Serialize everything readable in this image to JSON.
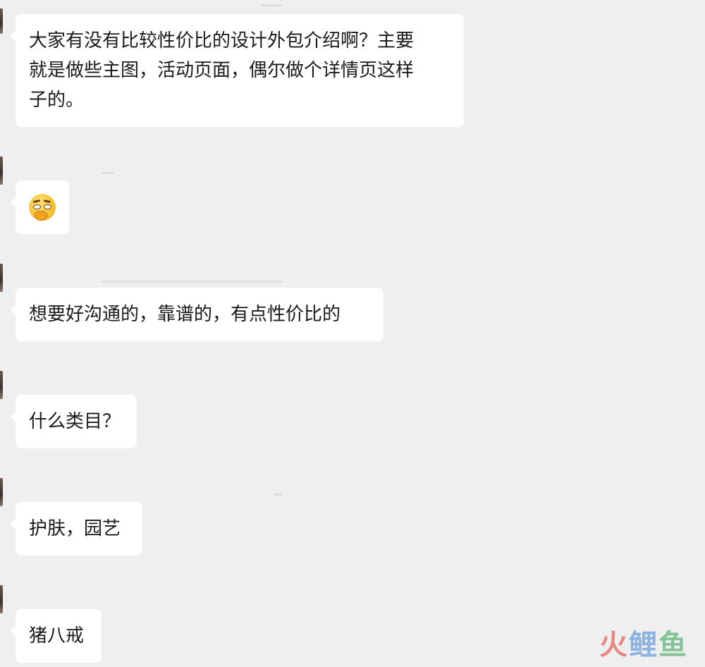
{
  "messages": [
    {
      "text": "大家有没有比较性价比的设计外包介绍啊？主要\n就是做些主图，活动页面，偶尔做个详情页这样\n子的。"
    },
    {
      "emoji": "thinking-face-icon"
    },
    {
      "text": "想要好沟通的，靠谱的，有点性价比的"
    },
    {
      "text": "什么类目？"
    },
    {
      "text": "护肤，园艺"
    },
    {
      "text": "猪八戒"
    }
  ],
  "watermark": {
    "c1": "火",
    "c2": "鲤",
    "c3": "鱼"
  },
  "colors": {
    "background": "#efefef",
    "bubble": "#ffffff",
    "text": "#1a1a1a"
  }
}
